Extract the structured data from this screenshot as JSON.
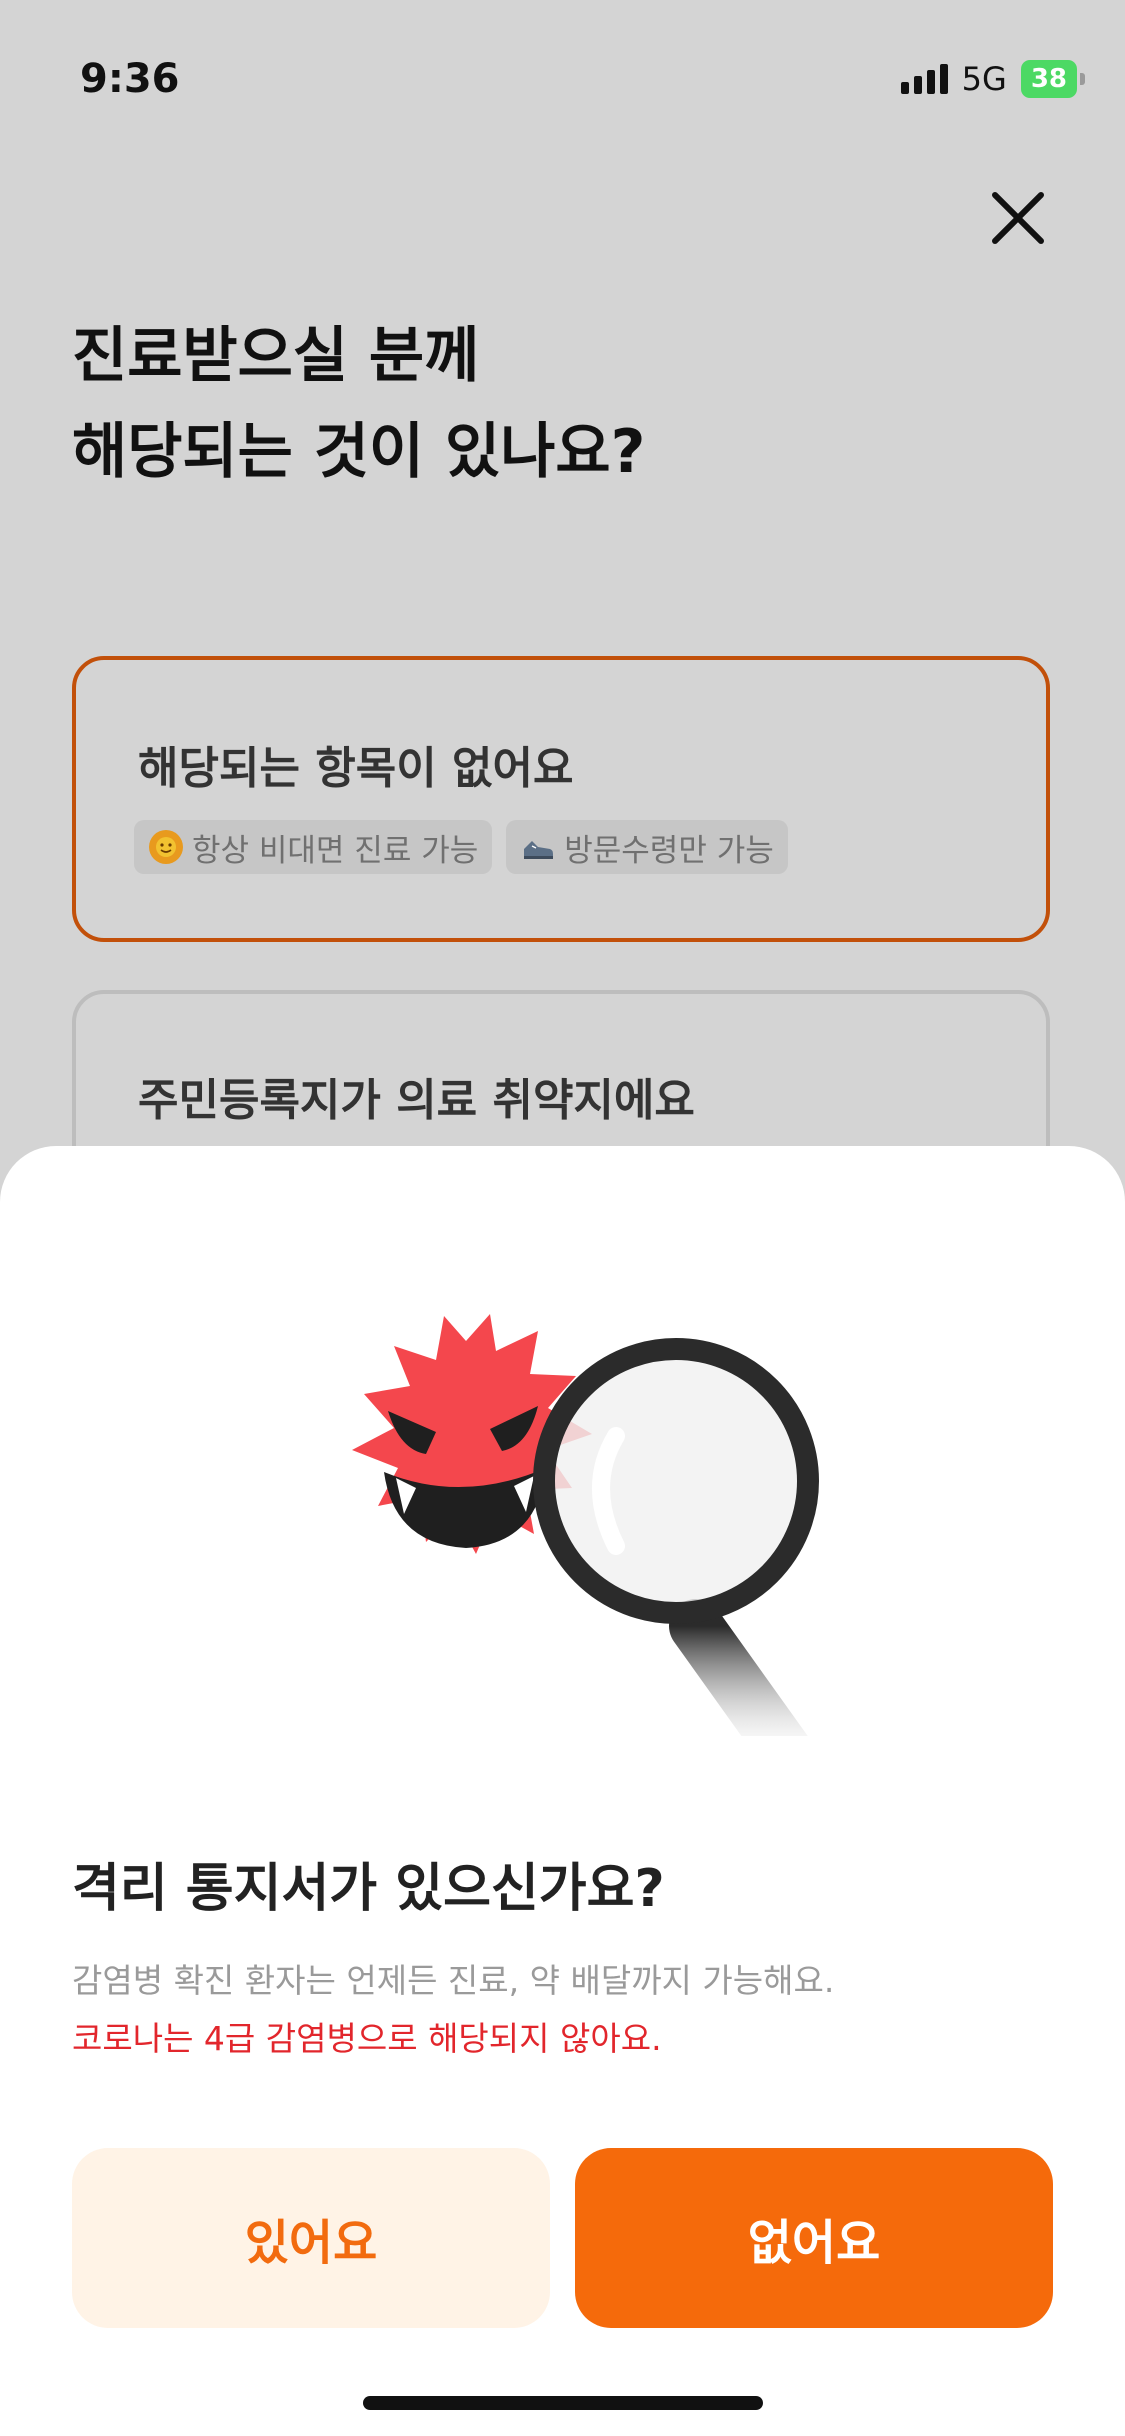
{
  "status_bar": {
    "time": "9:36",
    "network": "5G",
    "battery": "38"
  },
  "header": {
    "close_icon": "close-icon"
  },
  "question": {
    "title_line1": "진료받으실 분께",
    "title_line2": "해당되는 것이 있나요?"
  },
  "options": [
    {
      "label": "해당되는 항목이 없어요",
      "selected": true,
      "tags": [
        {
          "icon": "sun-icon",
          "text": "항상 비대면 진료 가능"
        },
        {
          "icon": "shoe-icon",
          "text": "방문수령만 가능"
        }
      ]
    },
    {
      "label": "주민등록지가 의료 취약지에요",
      "selected": false
    }
  ],
  "sheet": {
    "illustration": "virus-magnifier-illustration",
    "title": "격리 통지서가 있으신가요?",
    "description": "감염병 확진 환자는 언제든 진료, 약 배달까지 가능해요.",
    "warning": "코로나는 4급 감염병으로 해당되지 않아요.",
    "yes_label": "있어요",
    "no_label": "없어요"
  },
  "colors": {
    "accent": "#f56a0b",
    "accent_light": "#fff3e6",
    "warning": "#e2262c",
    "selected_border": "#c2500a"
  }
}
